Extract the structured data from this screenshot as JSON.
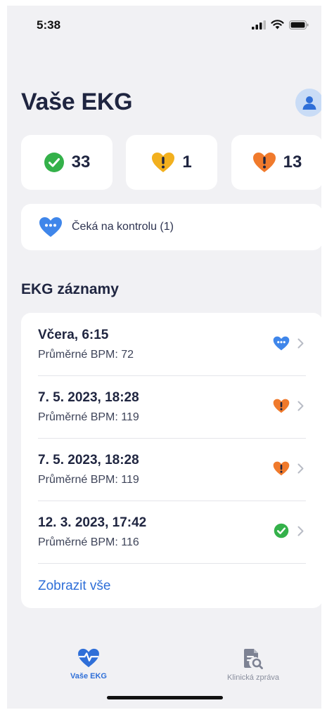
{
  "status_bar": {
    "time": "5:38"
  },
  "header": {
    "title": "Vaše EKG"
  },
  "summary": [
    {
      "count": "33",
      "icon": "check-circle-icon",
      "color": "#34b14a"
    },
    {
      "count": "1",
      "icon": "heart-warning-icon",
      "color": "#f2b01e"
    },
    {
      "count": "13",
      "icon": "heart-alert-icon",
      "color": "#f07a2c"
    }
  ],
  "pending": {
    "label": "Čeká na kontrolu (1)",
    "icon": "heart-pending-icon",
    "color": "#3f86ea"
  },
  "records": {
    "title": "EKG záznamy",
    "items": [
      {
        "date": "Včera, 6:15",
        "bpm": "Průměrné BPM: 72",
        "status": "pending"
      },
      {
        "date": "7. 5. 2023, 18:28",
        "bpm": "Průměrné BPM: 119",
        "status": "alert"
      },
      {
        "date": "7. 5. 2023, 18:28",
        "bpm": "Průměrné BPM: 119",
        "status": "alert"
      },
      {
        "date": "12. 3. 2023, 17:42",
        "bpm": "Průměrné BPM: 116",
        "status": "ok"
      }
    ],
    "show_all": "Zobrazit vše"
  },
  "tabs": [
    {
      "label": "Vaše EKG",
      "icon": "heart-pulse-icon",
      "active": true
    },
    {
      "label": "Klinická zpráva",
      "icon": "report-search-icon",
      "active": false
    }
  ],
  "colors": {
    "accent": "#2f6fd8",
    "background": "#f1f1f4",
    "title": "#1f2540"
  }
}
